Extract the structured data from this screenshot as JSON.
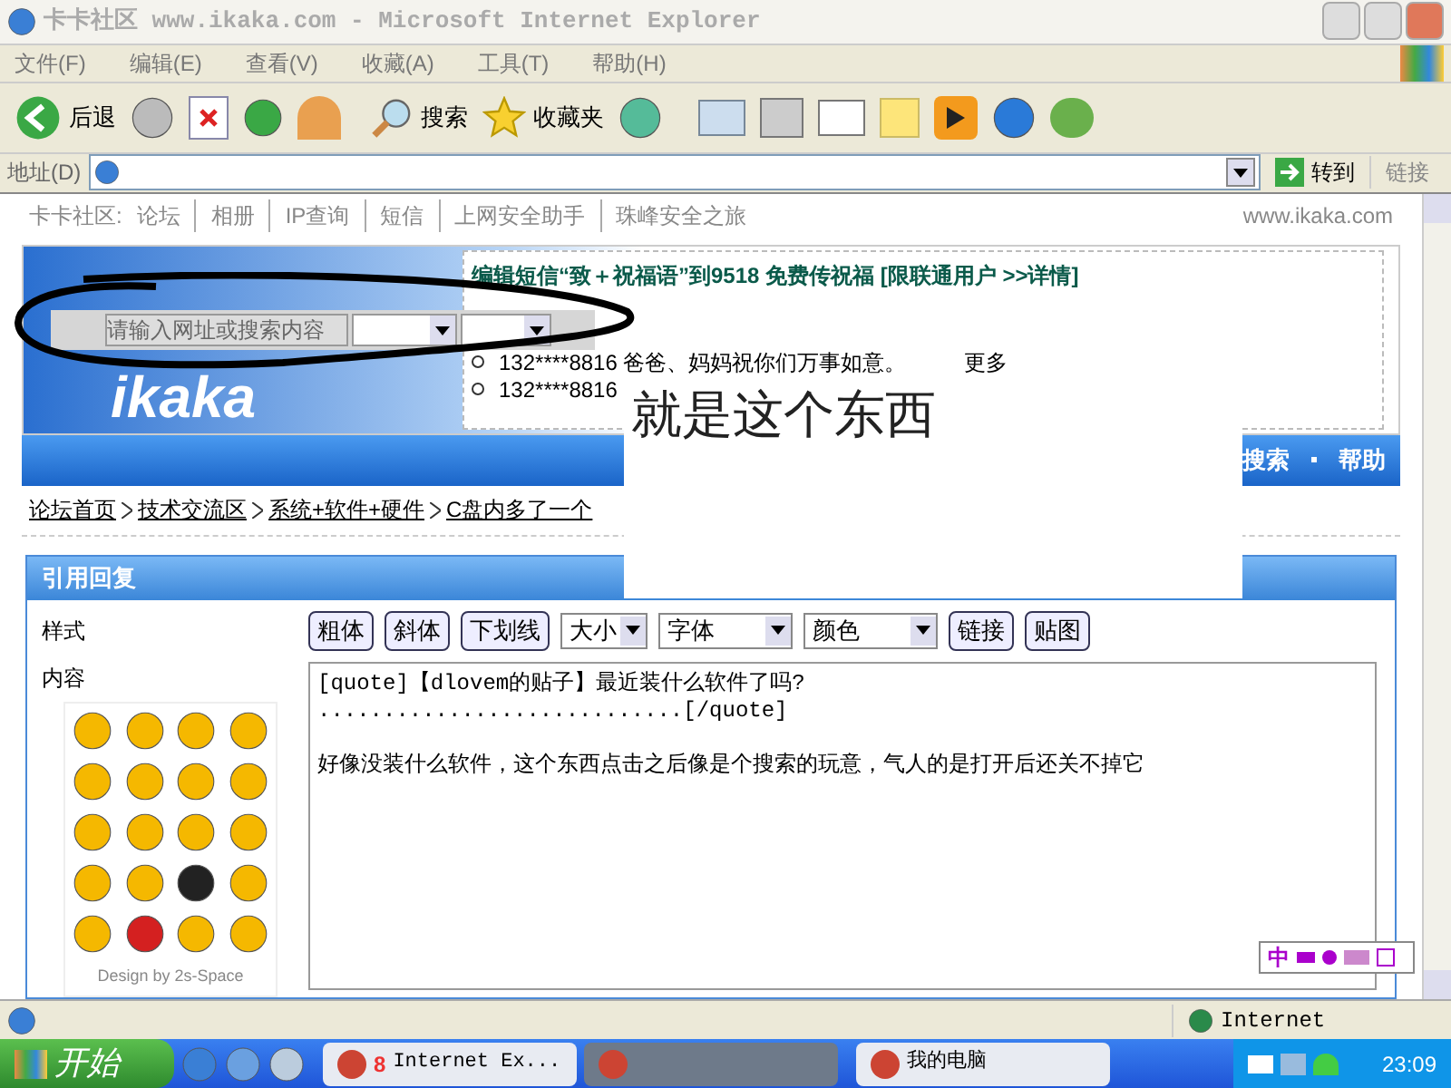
{
  "window": {
    "title": "卡卡社区 www.ikaka.com - Microsoft Internet Explorer"
  },
  "menu": [
    "文件(F)",
    "编辑(E)",
    "查看(V)",
    "收藏(A)",
    "工具(T)",
    "帮助(H)"
  ],
  "toolbar": {
    "back": "后退",
    "search": "搜索",
    "favorites": "收藏夹"
  },
  "address": {
    "label": "地址(D)",
    "go": "转到",
    "links": "链接"
  },
  "site_nav": {
    "label": "卡卡社区:",
    "links": [
      "论坛",
      "相册",
      "IP查询",
      "短信",
      "上网安全助手",
      "珠峰安全之旅"
    ],
    "domain": "www.ikaka.com"
  },
  "banner": {
    "logo": "ikaka",
    "headline": "编辑短信“致＋祝福语”到9518 免费传祝福 [限联通用户 >>详情]",
    "ticker": [
      {
        "text": "132****8816 爸爸、妈妈祝你们万事如意。",
        "more": "更多"
      },
      {
        "text": "132****8816"
      }
    ]
  },
  "nav_bar": [
    "搜索",
    "帮助"
  ],
  "breadcrumb": [
    "论坛首页",
    "技术交流区",
    "系统+软件+硬件",
    "C盘内多了一个"
  ],
  "reply": {
    "title": "引用回复",
    "style_label": "样式",
    "buttons": [
      "粗体",
      "斜体",
      "下划线"
    ],
    "selects": [
      "大小",
      "字体",
      "颜色"
    ],
    "buttons2": [
      "链接",
      "贴图"
    ],
    "content_label": "内容",
    "credit": "Design by 2s-Space",
    "content": "[quote]【dlovem的贴子】最近装什么软件了吗?\n............................[/quote]\n\n好像没装什么软件，这个东西点击之后像是个搜索的玩意，气人的是打开后还关不掉它"
  },
  "ime": {
    "mode": "中"
  },
  "overlay": {
    "annotation": "就是这个东西",
    "search_placeholder": "请输入网址或搜索内容"
  },
  "status_bar": {
    "zone": "Internet"
  },
  "taskbar": {
    "start": "开始",
    "tasks": [
      {
        "label": "Internet Ex...",
        "count": "8",
        "selected": false
      },
      {
        "selected": true
      },
      {
        "label": "我的电脑",
        "selected": false
      }
    ],
    "clock": "23:09"
  }
}
